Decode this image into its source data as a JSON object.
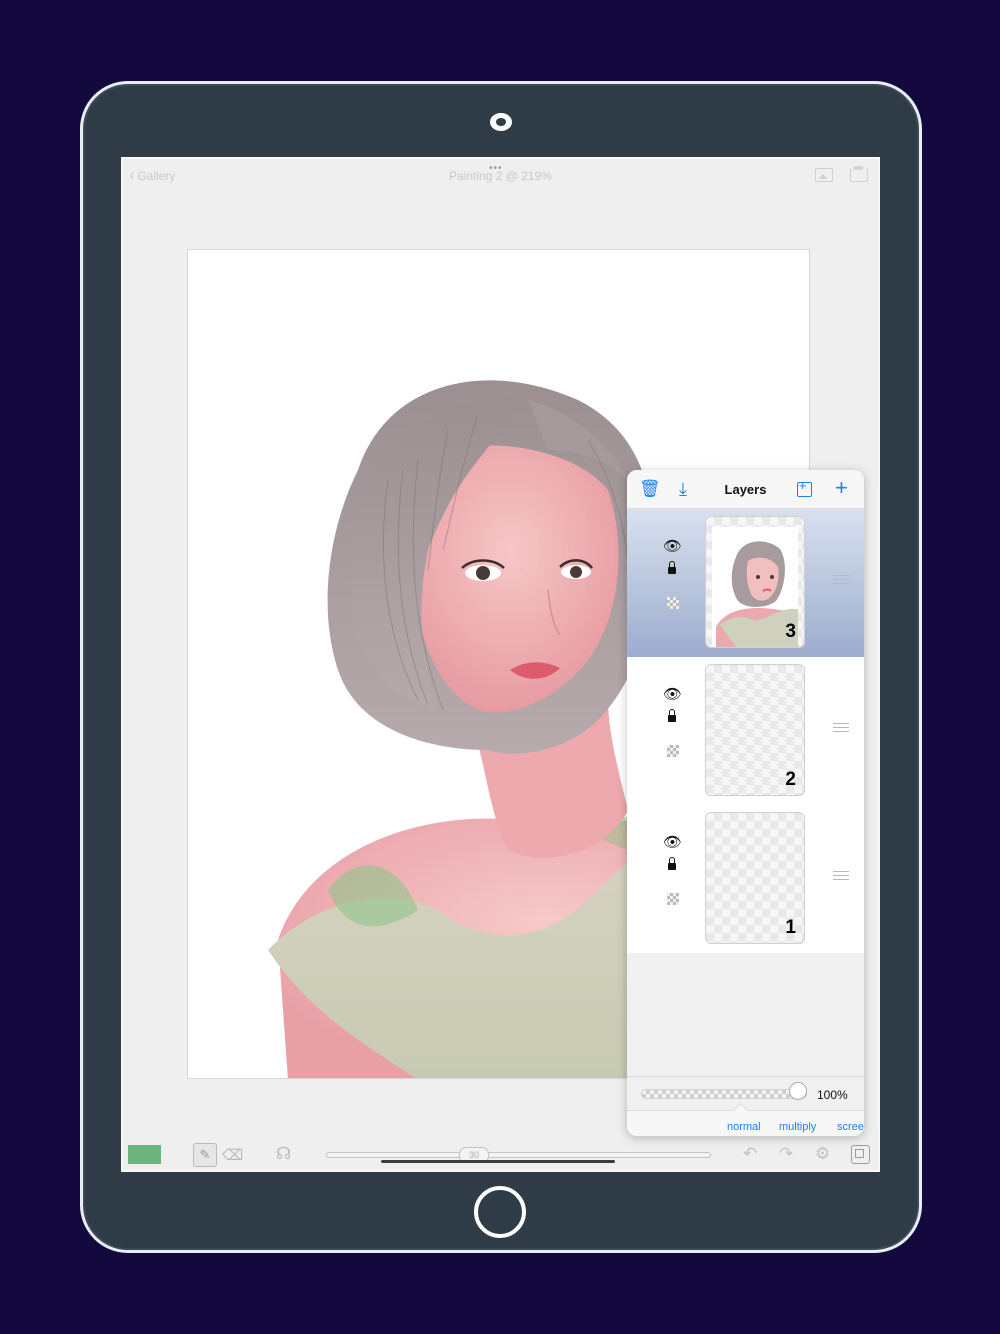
{
  "topbar": {
    "back_label": "Gallery",
    "title": "Painting 2 @ 219%",
    "more_dots": "•••"
  },
  "toolbar": {
    "current_color": "#6cb57e",
    "brush_size": "30",
    "icons": [
      "brush-icon",
      "eraser-icon",
      "smudge-icon",
      "undo-icon",
      "redo-icon",
      "gear-icon",
      "layers-icon"
    ]
  },
  "layers_panel": {
    "title": "Layers",
    "layers": [
      {
        "number": "3",
        "selected": true,
        "visible": true,
        "locked": true
      },
      {
        "number": "2",
        "selected": false,
        "visible": true,
        "locked": true
      },
      {
        "number": "1",
        "selected": false,
        "visible": true,
        "locked": true
      }
    ],
    "opacity": "100%",
    "blend_modes": [
      "normal",
      "multiply",
      "scree"
    ]
  },
  "colors": {
    "background": "#13093e",
    "device": "#2f3b47",
    "accent": "#1a7ff5",
    "selected_layer": "#9cacce"
  }
}
